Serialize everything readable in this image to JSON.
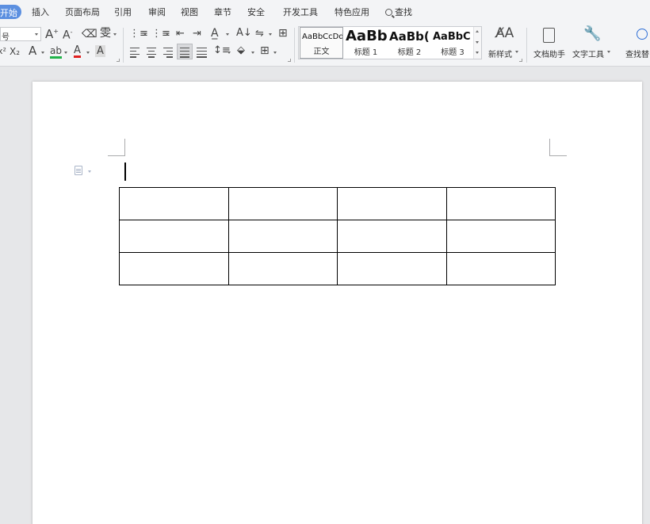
{
  "menu": {
    "tabs": [
      {
        "label": "开始",
        "active": true
      },
      {
        "label": "插入"
      },
      {
        "label": "页面布局"
      },
      {
        "label": "引用"
      },
      {
        "label": "审阅"
      },
      {
        "label": "视图"
      },
      {
        "label": "章节"
      },
      {
        "label": "安全"
      },
      {
        "label": "开发工具"
      },
      {
        "label": "特色应用"
      }
    ],
    "search_label": "查找"
  },
  "ribbon": {
    "font_size_value": "号",
    "styles": [
      {
        "sample": "AaBbCcDd",
        "name": "正文",
        "selected": true
      },
      {
        "sample": "AaBb",
        "name": "标题 1"
      },
      {
        "sample": "AaBb(",
        "name": "标题 2"
      },
      {
        "sample": "AaBbC",
        "name": "标题 3"
      }
    ],
    "new_style_label": "新样式",
    "doc_helper_label": "文档助手",
    "text_tools_label": "文字工具",
    "find_replace_label": "查找替"
  },
  "document": {
    "table": {
      "rows": 3,
      "cols": 4
    }
  },
  "colors": {
    "accent": "#5b8fe0",
    "highlight_green": "#21b34a",
    "font_color_red": "#e02020"
  }
}
